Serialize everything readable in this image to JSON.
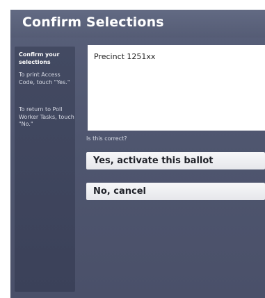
{
  "screen": {
    "title": "Confirm Selections"
  },
  "instructions": {
    "heading": "Confirm your selections",
    "print_text": "To print Access Code, touch \"Yes.\"",
    "return_text": "To return to Poll Worker Tasks, touch \"No.\""
  },
  "selection": {
    "text": "Precinct 1251xx"
  },
  "prompt": {
    "question": "Is this correct?"
  },
  "buttons": {
    "yes_label": "Yes, activate this ballot",
    "no_label": "No, cancel"
  }
}
